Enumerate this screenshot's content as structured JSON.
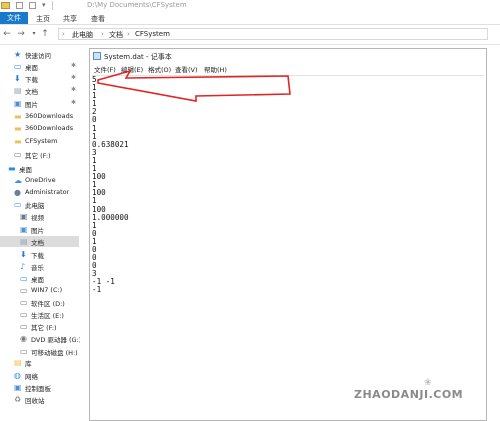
{
  "explorer": {
    "title_path": "D:\\My Documents\\CFSystem",
    "tabs": [
      "文件",
      "主页",
      "共享",
      "查看"
    ],
    "address": [
      "此电脑",
      "文档",
      "CFSystem"
    ]
  },
  "sidebar": {
    "items": [
      {
        "label": "快速访问",
        "icon": "star-icon",
        "color": "#2b7bd6",
        "pinned": false
      },
      {
        "label": "桌面",
        "icon": "desktop-icon",
        "color": "#2c8ee0",
        "pinned": true
      },
      {
        "label": "下载",
        "icon": "download-icon",
        "color": "#2b7bd6",
        "pinned": true
      },
      {
        "label": "文档",
        "icon": "document-icon",
        "color": "#8fa6bf",
        "pinned": true
      },
      {
        "label": "图片",
        "icon": "picture-icon",
        "color": "#4e8ed1",
        "pinned": true
      },
      {
        "label": "360Downloads",
        "icon": "folder-icon",
        "color": "#e8c25a",
        "pinned": false
      },
      {
        "label": "360Downloads",
        "icon": "folder-icon",
        "color": "#e8c25a",
        "pinned": false
      },
      {
        "label": "CFSystem",
        "icon": "folder-icon",
        "color": "#e8c25a",
        "pinned": false
      },
      {
        "label": "其它 (F:)",
        "icon": "drive-icon",
        "color": "#7a7a7a",
        "pinned": false
      },
      {
        "label": "桌面",
        "icon": "desktop-icon",
        "color": "#2c8ee0",
        "pinned": false
      },
      {
        "label": "OneDrive",
        "icon": "cloud-icon",
        "color": "#3d8fe0",
        "pinned": false
      },
      {
        "label": "Administrator",
        "icon": "user-icon",
        "color": "#6b7f99",
        "pinned": false
      },
      {
        "label": "此电脑",
        "icon": "computer-icon",
        "color": "#3d8fe0",
        "pinned": false
      },
      {
        "label": "视频",
        "icon": "video-icon",
        "color": "#6c7a89",
        "pinned": false
      },
      {
        "label": "图片",
        "icon": "picture-icon",
        "color": "#4e8ed1",
        "pinned": false
      },
      {
        "label": "文档",
        "icon": "document-icon",
        "color": "#8fa6bf",
        "pinned": false
      },
      {
        "label": "下载",
        "icon": "download-icon",
        "color": "#2b7bd6",
        "pinned": false
      },
      {
        "label": "音乐",
        "icon": "music-icon",
        "color": "#3d8fe0",
        "pinned": false
      },
      {
        "label": "桌面",
        "icon": "desktop-icon",
        "color": "#2c8ee0",
        "pinned": false
      },
      {
        "label": "WIN7 (C:)",
        "icon": "drive-icon",
        "color": "#7a7a7a",
        "pinned": false
      },
      {
        "label": "软件区 (D:)",
        "icon": "drive-icon",
        "color": "#7a7a7a",
        "pinned": false
      },
      {
        "label": "生活区 (E:)",
        "icon": "drive-icon",
        "color": "#7a7a7a",
        "pinned": false
      },
      {
        "label": "其它 (F:)",
        "icon": "drive-icon",
        "color": "#7a7a7a",
        "pinned": false
      },
      {
        "label": "DVD 驱动器 (G:)",
        "icon": "dvd-icon",
        "color": "#7a7a7a",
        "pinned": false
      },
      {
        "label": "可移动磁盘 (H:)",
        "icon": "removable-drive-icon",
        "color": "#7a7a7a",
        "pinned": false
      },
      {
        "label": "库",
        "icon": "library-icon",
        "color": "#e8c25a",
        "pinned": false
      },
      {
        "label": "网络",
        "icon": "network-icon",
        "color": "#3d8fe0",
        "pinned": false
      },
      {
        "label": "控制面板",
        "icon": "control-panel-icon",
        "color": "#4e8ed1",
        "pinned": false
      },
      {
        "label": "回收站",
        "icon": "recycle-bin-icon",
        "color": "#8a8a8a",
        "pinned": false
      }
    ],
    "selected_label": "文档"
  },
  "notepad": {
    "title": "System.dat - 记事本",
    "menu": [
      "文件(F)",
      "编辑(E)",
      "格式(O)",
      "查看(V)",
      "帮助(H)"
    ],
    "lines": [
      "5",
      "1",
      "1",
      "1",
      "2",
      "0",
      "1",
      "1",
      "0.638021",
      "3",
      "1",
      "1",
      "100",
      "1",
      "100",
      "1",
      "100",
      "1.000000",
      "1",
      "0",
      "1",
      "0",
      "0",
      "0",
      "3",
      "-1 -1",
      "-1"
    ]
  },
  "annotation": {
    "arrow_color": "#e02525"
  },
  "watermark": {
    "text": "ZHAODANJI.COM"
  }
}
